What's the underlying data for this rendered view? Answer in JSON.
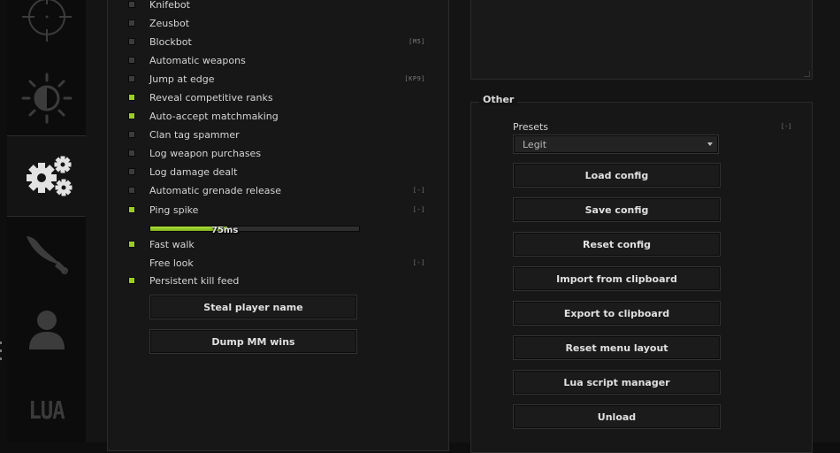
{
  "tabs": [
    {
      "icon": "crosshair-icon",
      "active": false
    },
    {
      "icon": "brightness-icon",
      "active": false
    },
    {
      "icon": "gears-icon",
      "active": true
    },
    {
      "icon": "karambit-knife-icon",
      "active": false
    },
    {
      "icon": "user-icon",
      "active": false
    },
    {
      "icon": "lua-icon",
      "text": "LUA",
      "active": false
    }
  ],
  "misc": {
    "items": [
      {
        "label": "Knifebot",
        "checked": false,
        "hint": ""
      },
      {
        "label": "Zeusbot",
        "checked": false,
        "hint": ""
      },
      {
        "label": "Blockbot",
        "checked": false,
        "hint": "[M5]"
      },
      {
        "label": "Automatic weapons",
        "checked": false,
        "hint": ""
      },
      {
        "label": "Jump at edge",
        "checked": false,
        "hint": "[KP9]"
      },
      {
        "label": "Reveal competitive ranks",
        "checked": true,
        "hint": ""
      },
      {
        "label": "Auto-accept matchmaking",
        "checked": true,
        "hint": ""
      },
      {
        "label": "Clan tag spammer",
        "checked": false,
        "hint": ""
      },
      {
        "label": "Log weapon purchases",
        "checked": false,
        "hint": ""
      },
      {
        "label": "Log damage dealt",
        "checked": false,
        "hint": ""
      },
      {
        "label": "Automatic grenade release",
        "checked": false,
        "hint": "[-]"
      },
      {
        "label": "Ping spike",
        "checked": true,
        "hint": "[-]"
      },
      {
        "label": "Fast walk",
        "checked": true,
        "hint": ""
      },
      {
        "label": "Free look",
        "checked": null,
        "hint": "[-]"
      },
      {
        "label": "Persistent kill feed",
        "checked": true,
        "hint": ""
      }
    ],
    "ping_slider": {
      "value_label": "75ms",
      "fraction": 0.37
    },
    "steal_name_label": "Steal player name",
    "dump_wins_label": "Dump MM wins"
  },
  "other": {
    "title": "Other",
    "presets_label": "Presets",
    "presets_hint": "[-]",
    "preset_selected": "Legit",
    "buttons": [
      "Load config",
      "Save config",
      "Reset config",
      "Import from clipboard",
      "Export to clipboard",
      "Reset menu layout",
      "Lua script manager",
      "Unload"
    ]
  },
  "colors": {
    "accent": "#9ccc26",
    "background": "#141414",
    "checkbox_off": "#3c3c3c"
  }
}
